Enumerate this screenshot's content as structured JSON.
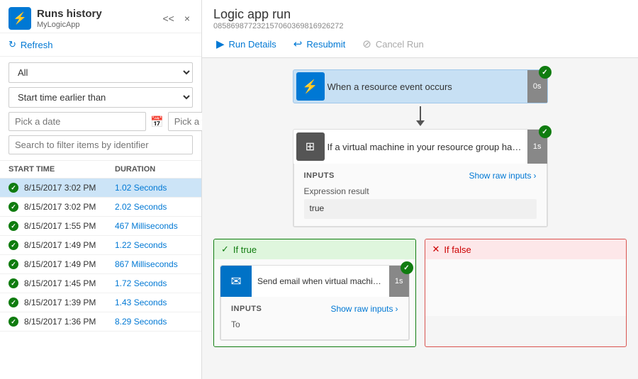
{
  "sidebar": {
    "title": "Runs history",
    "subtitle": "MyLogicApp",
    "collapse_label": "<<",
    "close_label": "×",
    "refresh_label": "Refresh",
    "filter_options": [
      "All"
    ],
    "filter_selected": "All",
    "start_time_filter": "Start time earlier than",
    "date_placeholder": "Pick a date",
    "time_placeholder": "Pick a time",
    "search_placeholder": "Search to filter items by identifier",
    "columns": {
      "start_time": "START TIME",
      "duration": "DURATION"
    },
    "runs": [
      {
        "time": "8/15/2017 3:02 PM",
        "duration": "1.02 Seconds",
        "selected": true
      },
      {
        "time": "8/15/2017 3:02 PM",
        "duration": "2.02 Seconds",
        "selected": false
      },
      {
        "time": "8/15/2017 1:55 PM",
        "duration": "467 Milliseconds",
        "selected": false
      },
      {
        "time": "8/15/2017 1:49 PM",
        "duration": "1.22 Seconds",
        "selected": false
      },
      {
        "time": "8/15/2017 1:49 PM",
        "duration": "867 Milliseconds",
        "selected": false
      },
      {
        "time": "8/15/2017 1:45 PM",
        "duration": "1.72 Seconds",
        "selected": false
      },
      {
        "time": "8/15/2017 1:39 PM",
        "duration": "1.43 Seconds",
        "selected": false
      },
      {
        "time": "8/15/2017 1:36 PM",
        "duration": "8.29 Seconds",
        "selected": false
      }
    ]
  },
  "main": {
    "title": "Logic app run",
    "subtitle": "085869877232157060369816926272",
    "toolbar": {
      "run_details": "Run Details",
      "resubmit": "Resubmit",
      "cancel_run": "Cancel Run"
    },
    "nodes": {
      "trigger": {
        "label": "When a resource event occurs",
        "duration": "0s"
      },
      "condition": {
        "label": "If a virtual machine in your resource group has...",
        "duration": "1s",
        "inputs_title": "INPUTS",
        "show_raw": "Show raw inputs",
        "expression_label": "Expression result",
        "expression_value": "true"
      },
      "branch_true": {
        "label": "If true",
        "check_icon": "✓"
      },
      "branch_false": {
        "label": "If false",
        "x_icon": "✕"
      },
      "send_email": {
        "label": "Send email when virtual machine updat...",
        "duration": "1s",
        "inputs_title": "INPUTS",
        "show_raw": "Show raw inputs",
        "to_label": "To"
      }
    }
  }
}
